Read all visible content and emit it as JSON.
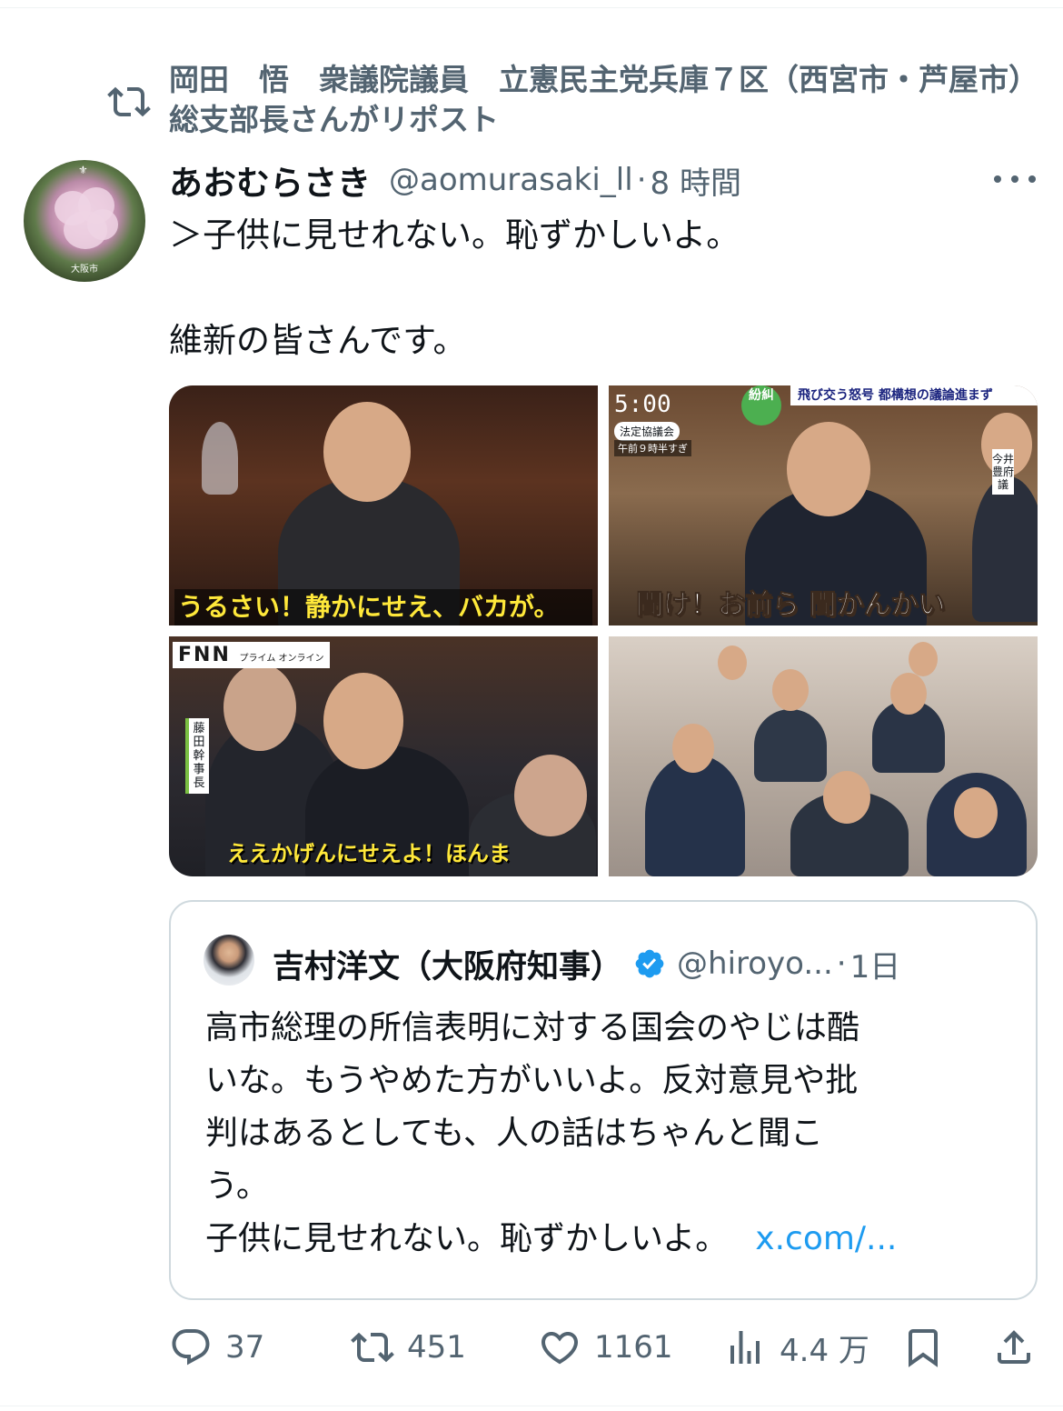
{
  "repost_context": {
    "text": "岡田　悟　衆議院議員　立憲民主党兵庫７区（西宮市・芦屋市）総支部長さんがリポスト"
  },
  "post": {
    "author_name": "あおむらさき",
    "author_handle": "@aomurasaki_ll",
    "separator": "·",
    "time": "8 時間",
    "avatar_caption": "大阪市",
    "body_lines": [
      "＞子供に見せれない。恥ずかしいよ。",
      "",
      "維新の皆さんです。"
    ]
  },
  "images": [
    {
      "caption": "うるさい！静かにせえ、バカが。"
    },
    {
      "clock": "5:00",
      "tag": "法定協議会",
      "tag2": "午前９時半すぎ",
      "seal": "紛糾",
      "banner": "飛び交う怒号 都構想の議論進まず",
      "vertical_label": "今井豊府議",
      "caption": "聞け！お前ら 聞かんかい"
    },
    {
      "logo": "FNN",
      "logo_sub": "プライム オンライン",
      "vertical_label": "藤田幹事長",
      "caption": "ええかげんにせえよ！ほんま"
    },
    {}
  ],
  "quote": {
    "author_name": "吉村洋文（大阪府知事）",
    "author_handle": "@hiroyo...",
    "separator": "·",
    "time": "1日",
    "verified": true,
    "lines": [
      "高市総理の所信表明に対する国会のやじは酷",
      "いな。もうやめた方がいいよ。反対意見や批",
      "判はあるとしても、人の話はちゃんと聞こ",
      "う。"
    ],
    "last_line": "子供に見せれない。恥ずかしいよ。",
    "link": "x.com/..."
  },
  "actions": {
    "replies": "37",
    "reposts": "451",
    "likes": "1161",
    "views": "4.4 万"
  },
  "colors": {
    "text_primary": "#0f1419",
    "text_secondary": "#536471",
    "link": "#1d9bf0",
    "border": "#cfd9de"
  }
}
